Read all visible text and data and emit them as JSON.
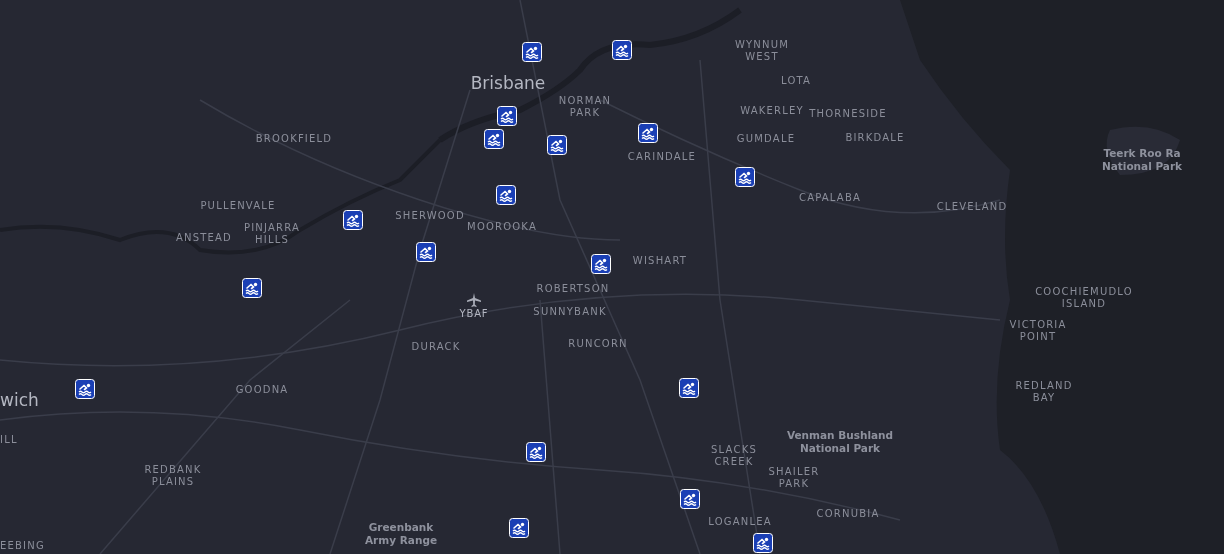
{
  "map": {
    "labels": [
      {
        "text": "Brisbane",
        "kind": "city"
      },
      {
        "text": "WYNNUM\nWEST",
        "kind": "suburb"
      },
      {
        "text": "LOTA",
        "kind": "suburb"
      },
      {
        "text": "NORMAN\nPARK",
        "kind": "suburb"
      },
      {
        "text": "WAKERLEY",
        "kind": "suburb"
      },
      {
        "text": "THORNESIDE",
        "kind": "suburb"
      },
      {
        "text": "BROOKFIELD",
        "kind": "suburb"
      },
      {
        "text": "GUMDALE",
        "kind": "suburb"
      },
      {
        "text": "BIRKDALE",
        "kind": "suburb"
      },
      {
        "text": "CARINDALE",
        "kind": "suburb"
      },
      {
        "text": "Teerk Roo Ra\nNational Park",
        "kind": "park"
      },
      {
        "text": "PULLENVALE",
        "kind": "suburb"
      },
      {
        "text": "CAPALABA",
        "kind": "suburb"
      },
      {
        "text": "CLEVELAND",
        "kind": "suburb"
      },
      {
        "text": "SHERWOOD",
        "kind": "suburb"
      },
      {
        "text": "ANSTEAD",
        "kind": "suburb"
      },
      {
        "text": "PINJARRA\nHILLS",
        "kind": "suburb"
      },
      {
        "text": "MOOROOKA",
        "kind": "suburb"
      },
      {
        "text": "WISHART",
        "kind": "suburb"
      },
      {
        "text": "ROBERTSON",
        "kind": "suburb"
      },
      {
        "text": "YBAF",
        "kind": "airport"
      },
      {
        "text": "SUNNYBANK",
        "kind": "suburb"
      },
      {
        "text": "COOCHIEMUDLO\nISLAND",
        "kind": "suburb"
      },
      {
        "text": "VICTORIA\nPOINT",
        "kind": "suburb"
      },
      {
        "text": "RUNCORN",
        "kind": "suburb"
      },
      {
        "text": "DURACK",
        "kind": "suburb"
      },
      {
        "text": "wich",
        "kind": "city"
      },
      {
        "text": "GOODNA",
        "kind": "suburb"
      },
      {
        "text": "REDLAND\nBAY",
        "kind": "suburb"
      },
      {
        "text": "ILL",
        "kind": "suburb"
      },
      {
        "text": "Venman Bushland\nNational Park",
        "kind": "park"
      },
      {
        "text": "REDBANK\nPLAINS",
        "kind": "suburb"
      },
      {
        "text": "SLACKS\nCREEK",
        "kind": "suburb"
      },
      {
        "text": "SHAILER\nPARK",
        "kind": "suburb"
      },
      {
        "text": "Greenbank\nArmy Range",
        "kind": "park"
      },
      {
        "text": "LOGANLEA",
        "kind": "suburb"
      },
      {
        "text": "CORNUBIA",
        "kind": "suburb"
      },
      {
        "text": "EEBING",
        "kind": "suburb"
      }
    ]
  }
}
